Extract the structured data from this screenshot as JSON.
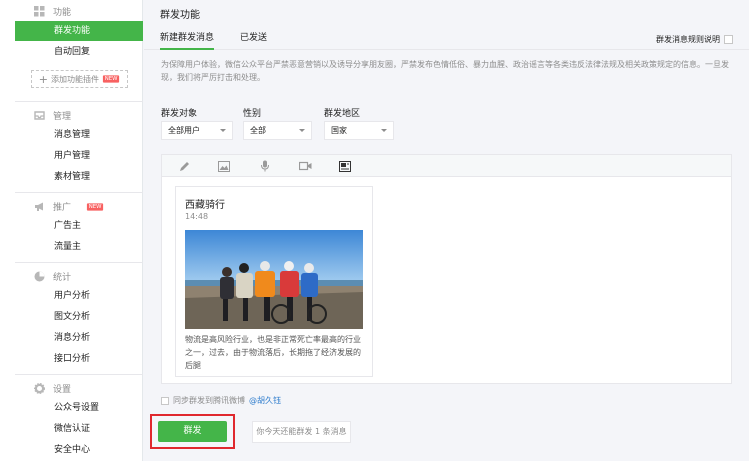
{
  "sidebar": {
    "sections": [
      {
        "label": "功能",
        "icon": "grid-icon",
        "items": [
          "群发功能",
          "自动回复"
        ]
      },
      {
        "label": "管理",
        "icon": "inbox-icon",
        "items": [
          "消息管理",
          "用户管理",
          "素材管理"
        ]
      },
      {
        "label": "推广",
        "icon": "megaphone-icon",
        "items": [
          "广告主",
          "流量主"
        ]
      },
      {
        "label": "统计",
        "icon": "pie-chart-icon",
        "items": [
          "用户分析",
          "图文分析",
          "消息分析",
          "接口分析"
        ]
      },
      {
        "label": "设置",
        "icon": "gear-icon",
        "items": [
          "公众号设置",
          "微信认证",
          "安全中心"
        ]
      }
    ],
    "add_plugin_label": "添加功能插件",
    "new_badge": "NEW",
    "active_item": "群发功能"
  },
  "main": {
    "title": "群发功能",
    "tabs": [
      "新建群发消息",
      "已发送"
    ],
    "rule_link": "群发消息规则说明",
    "notice": "为保障用户体验，微信公众平台严禁恶意营销以及诱导分享朋友圈，严禁发布色情低俗、暴力血腥、政治谣言等各类违反法律法规及相关政策规定的信息。一旦发现，我们将严厉打击和处理。",
    "filters": [
      {
        "label": "群发对象",
        "value": "全部用户"
      },
      {
        "label": "性别",
        "value": "全部"
      },
      {
        "label": "群发地区",
        "value": "国家"
      }
    ],
    "toolbar_icons": [
      "pencil-icon",
      "image-icon",
      "microphone-icon",
      "video-icon",
      "news-card-icon"
    ],
    "card": {
      "title": "西藏骑行",
      "time": "14:48",
      "description": "物流是高风险行业，也是非正常死亡率最高的行业之一，过去，由于物流落后，长期拖了经济发展的后腿"
    },
    "sync_label": "同步群发到腾讯微博",
    "sync_handle": "@胡久钰",
    "send_label": "群发",
    "remaining_text": "你今天还能群发 1 条消息"
  },
  "colors": {
    "accent": "#44b549",
    "highlight_frame": "#e0282e",
    "link": "#2f7dcd"
  }
}
